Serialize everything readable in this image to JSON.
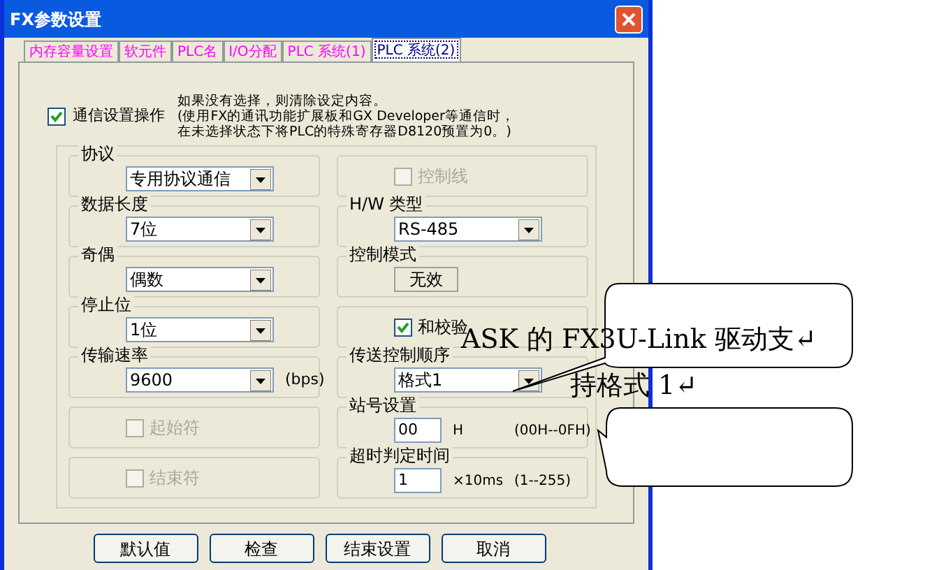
{
  "window": {
    "title": "FX参数设置"
  },
  "tabs": [
    {
      "label": "内存容量设置",
      "selected": false
    },
    {
      "label": "软元件",
      "selected": false
    },
    {
      "label": "PLC名",
      "selected": false
    },
    {
      "label": "I/O分配",
      "selected": false
    },
    {
      "label": "PLC 系统(1)",
      "selected": false
    },
    {
      "label": "PLC 系统(2)",
      "selected": true
    }
  ],
  "comm_setting": {
    "label": "通信设置操作",
    "checked": true,
    "note_lines": [
      "如果没有选择，则清除设定内容。",
      "(使用FX的通讯功能扩展板和GX Developer等通信时，",
      "在未选择状态下将PLC的特殊寄存器D8120预置为0。)"
    ]
  },
  "left_groups": [
    {
      "kind": "select",
      "label": "协议",
      "value": "专用协议通信"
    },
    {
      "kind": "select",
      "label": "数据长度",
      "value": "7位"
    },
    {
      "kind": "select",
      "label": "奇偶",
      "value": "偶数"
    },
    {
      "kind": "select",
      "label": "停止位",
      "value": "1位"
    },
    {
      "kind": "select",
      "label": "传输速率",
      "value": "9600",
      "suffix": "(bps)"
    },
    {
      "kind": "checkbox",
      "label": "起始符",
      "checked": false,
      "disabled": true
    },
    {
      "kind": "checkbox",
      "label": "结束符",
      "checked": false,
      "disabled": true
    }
  ],
  "right_groups": [
    {
      "kind": "checkbox",
      "label": "控制线",
      "checked": false,
      "disabled": true
    },
    {
      "kind": "select",
      "label": "H/W 类型",
      "value": "RS-485"
    },
    {
      "kind": "static",
      "label": "控制模式",
      "value": "无效"
    },
    {
      "kind": "checkbox",
      "label": "和校验",
      "checked": true,
      "disabled": false
    },
    {
      "kind": "select",
      "label": "传送控制顺序",
      "value": "格式1"
    },
    {
      "kind": "input",
      "label": "站号设置",
      "value": "00",
      "unit": "H",
      "range": "(00H--0FH)"
    },
    {
      "kind": "input",
      "label": "超时判定时间",
      "value": "1",
      "unit": "×10ms",
      "range": "(1--255)"
    }
  ],
  "buttons": [
    "默认值",
    "检查",
    "结束设置",
    "取消"
  ],
  "annotation": {
    "lines": [
      "ASK 的 FX3U-Link 驱动支↵",
      "持格式 1↵"
    ]
  }
}
